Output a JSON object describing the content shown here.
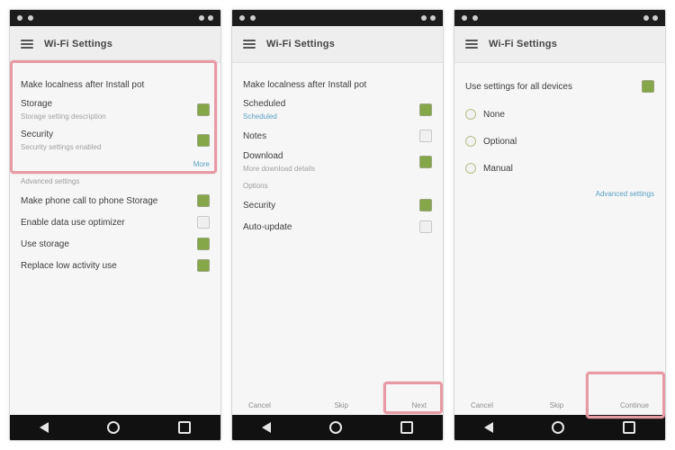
{
  "phones": [
    {
      "status": {
        "left": "",
        "right": ""
      },
      "appbar": {
        "title": "Wi-Fi Settings"
      },
      "content": {
        "header": "Make localness after Install pot",
        "toggles": [
          {
            "label": "Storage",
            "sub": "Storage setting description",
            "checked": true
          },
          {
            "label": "Security",
            "sub": "Security settings enabled",
            "checked": true
          }
        ],
        "link_right": "More",
        "section": "Advanced settings",
        "group": [
          {
            "label": "Make phone call to phone Storage",
            "checked": true
          },
          {
            "label": "Enable data use optimizer",
            "checked": false
          }
        ],
        "checkbox_list": [
          {
            "label": "Use storage",
            "checked": true
          },
          {
            "label": "Replace low activity use",
            "checked": true
          }
        ]
      },
      "bottom_actions": {
        "left": "",
        "center": "",
        "right": ""
      },
      "nav": {
        "back": "back-icon",
        "home": "home-icon",
        "recent": "recent-icon"
      }
    },
    {
      "status": {
        "left": "",
        "right": ""
      },
      "appbar": {
        "title": "Wi-Fi Settings"
      },
      "content": {
        "header": "Make localness after Install pot",
        "toggles": [
          {
            "label": "Scheduled",
            "sub": "Scheduled",
            "checked": true
          },
          {
            "label": "Notes",
            "sub": "",
            "checked": false
          },
          {
            "label": "Download",
            "sub": "More download details",
            "checked": true
          }
        ],
        "section": "Options",
        "group": [
          {
            "label": "Security",
            "checked": true
          },
          {
            "label": "Auto-update",
            "checked": false
          }
        ]
      },
      "bottom_actions": {
        "left": "Cancel",
        "center": "Skip",
        "right": "Next"
      },
      "nav": {
        "back": "back-icon",
        "home": "home-icon",
        "recent": "recent-icon"
      }
    },
    {
      "status": {
        "left": "",
        "right": ""
      },
      "appbar": {
        "title": "Wi-Fi Settings"
      },
      "content": {
        "header": "Use settings for all devices",
        "main_toggle": {
          "label": "Use settings for all devices",
          "checked": true
        },
        "radios": [
          {
            "label": "None"
          },
          {
            "label": "Optional"
          },
          {
            "label": "Manual"
          }
        ],
        "link_right": "Advanced settings"
      },
      "bottom_actions": {
        "left": "Cancel",
        "center": "Skip",
        "right": "Continue"
      },
      "nav": {
        "back": "back-icon",
        "home": "home-icon",
        "recent": "recent-icon"
      }
    }
  ]
}
